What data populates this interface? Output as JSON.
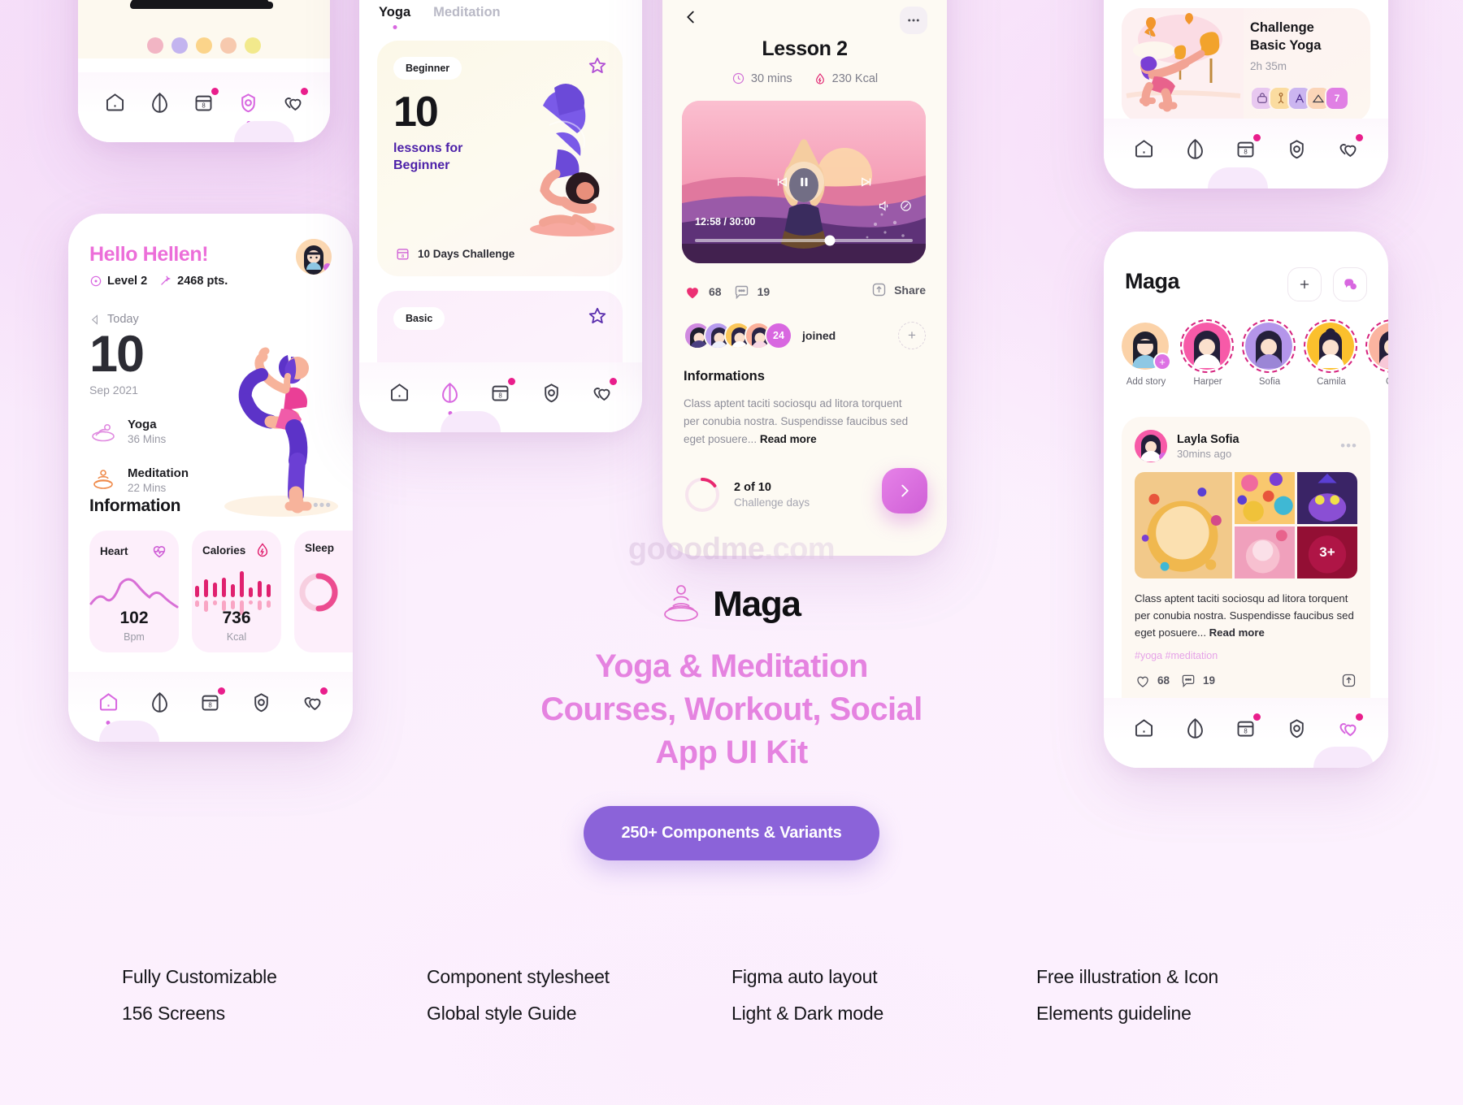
{
  "brand": {
    "name": "Maga",
    "logo_icon": "lotus-meditation-icon"
  },
  "hero": {
    "tagline_line1": "Yoga & Meditation",
    "tagline_line2": "Courses, Workout, Social",
    "tagline_line3": "App UI Kit",
    "cta_label": "250+ Components & Variants",
    "watermark": "gooodme",
    "watermark_suffix": ".com",
    "accent_pink": "#e583e0",
    "accent_purple": "#8b63d9"
  },
  "features": [
    {
      "items": [
        "Fully Customizable",
        "156 Screens"
      ]
    },
    {
      "items": [
        "Component stylesheet",
        "Global style Guide"
      ]
    },
    {
      "items": [
        "Figma auto layout",
        "Light & Dark mode"
      ]
    },
    {
      "items": [
        "Free illustration & Icon",
        "Elements guideline"
      ]
    }
  ],
  "nav": {
    "items": [
      {
        "name": "home",
        "badge": null
      },
      {
        "name": "leaf",
        "badge": null
      },
      {
        "name": "calendar",
        "badge": "dot",
        "label": "8"
      },
      {
        "name": "lock",
        "badge": null
      },
      {
        "name": "favorites",
        "badge": "dot"
      }
    ]
  },
  "phone_home": {
    "greeting_prefix": "Hello ",
    "greeting_name": "Hellen!",
    "level": "Level 2",
    "points": "2468 pts.",
    "today_label": "Today",
    "day": "10",
    "month_year": "Sep 2021",
    "activities": [
      {
        "icon": "yoga-mat-icon",
        "title": "Yoga",
        "duration": "36 Mins"
      },
      {
        "icon": "meditation-icon",
        "title": "Meditation",
        "duration": "22 Mins"
      }
    ],
    "information_title": "Information",
    "more_label": "•••",
    "stats": [
      {
        "title": "Heart",
        "icon": "heart-pulse-icon",
        "value": "102",
        "unit": "Bpm",
        "chart_type": "line"
      },
      {
        "title": "Calories",
        "icon": "calorie-drop-icon",
        "value": "736",
        "unit": "Kcal",
        "chart_type": "bars"
      },
      {
        "title": "Sleep",
        "icon": "sleep-icon",
        "value": "",
        "unit": "",
        "chart_type": "ring"
      }
    ]
  },
  "phone_lessons": {
    "tabs": [
      {
        "label": "Yoga",
        "active": true
      },
      {
        "label": "Meditation",
        "active": false
      }
    ],
    "card1": {
      "badge": "Beginner",
      "number": "10",
      "desc_line1": "lessons for",
      "desc_line2": "Beginner",
      "challenge_label": "10 Days Challenge",
      "challenge_icon": "calendar-icon",
      "star_icon": "star-outline-icon"
    },
    "card2": {
      "badge": "Basic",
      "star_icon": "star-outline-icon"
    }
  },
  "phone_lesson_detail": {
    "back_icon": "chevron-left-icon",
    "more_icon": "dots-horizontal-icon",
    "title": "Lesson 2",
    "duration": "30 mins",
    "calories": "230 Kcal",
    "video": {
      "time_current": "12:58",
      "time_total": "30:00",
      "time_display": "12:58 / 30:00",
      "progress_percent": 62,
      "rewind_icon": "rewind-icon",
      "play_icon": "pause-icon",
      "forward_icon": "forward-icon",
      "volume_icon": "volume-icon",
      "fullscreen_icon": "expand-icon"
    },
    "likes": "68",
    "comments": "19",
    "share_label": "Share",
    "joined_count": "24",
    "joined_label": "joined",
    "info_heading": "Informations",
    "info_text": "Class aptent taciti sociosqu ad litora torquent per conubia nostra. Suspendisse faucibus sed eget posuere...",
    "read_more": "Read more",
    "challenge_progress": "2 of 10",
    "challenge_sub": "Challenge days",
    "next_icon": "chevron-right-icon"
  },
  "phone_challenge": {
    "title_line1": "Challenge",
    "title_line2": "Basic Yoga",
    "duration": "2h 35m",
    "icon_badges": [
      "yoga-bag-icon",
      "yoga-pose-icon",
      "yoga-stretch-icon",
      "yoga-bridge-icon"
    ],
    "extra_count": "7"
  },
  "phone_social": {
    "title": "Maga",
    "add_icon": "plus-icon",
    "chat_icon": "chat-bubble-icon",
    "stories": [
      {
        "label": "Add story",
        "has_add": true,
        "ring": false,
        "color": "#fbd2a8"
      },
      {
        "label": "Harper",
        "has_add": false,
        "ring": true,
        "color": "#f75aa8"
      },
      {
        "label": "Sofia",
        "has_add": false,
        "ring": true,
        "color": "#b495ea"
      },
      {
        "label": "Camila",
        "has_add": false,
        "ring": true,
        "color": "#fbc02d"
      },
      {
        "label": "Gla",
        "has_add": false,
        "ring": true,
        "color": "#fbb4a0"
      }
    ],
    "post": {
      "author": "Layla Sofia",
      "time": "30mins ago",
      "more_icon": "dots-horizontal-icon",
      "media_extra": "3+",
      "text": "Class aptent taciti sociosqu ad litora torquent per conubia nostra. Suspendisse faucibus sed eget posuere...",
      "read_more": "Read more",
      "tags": "#yoga #meditation",
      "likes": "68",
      "comments": "19",
      "share_icon": "share-icon"
    }
  }
}
